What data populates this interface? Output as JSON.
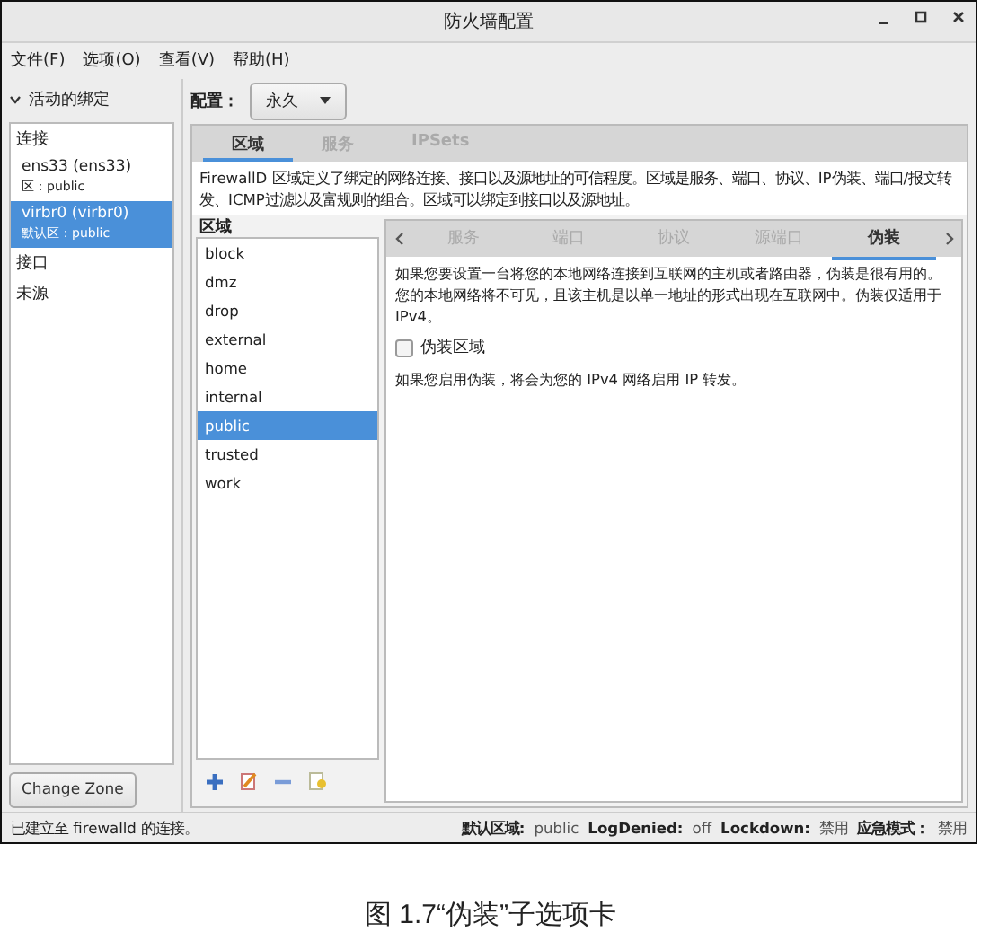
{
  "window": {
    "title": "防火墙配置"
  },
  "menu": [
    "文件(F)",
    "选项(O)",
    "查看(V)",
    "帮助(H)"
  ],
  "sidebar": {
    "header": "活动的绑定",
    "expanded": true,
    "sections": [
      {
        "title": "连接",
        "items": [
          {
            "name": "ens33 (ens33)",
            "detail": "区：public",
            "selected": false
          },
          {
            "name": "virbr0 (virbr0)",
            "detail": "默认区：public",
            "selected": true
          }
        ]
      },
      {
        "title": "接口"
      },
      {
        "title": "未源"
      }
    ],
    "button": "Change Zone"
  },
  "config": {
    "label": "配置：",
    "value": "永久"
  },
  "tabs": [
    {
      "label": "区域",
      "selected": true
    },
    {
      "label": "服务",
      "selected": false
    },
    {
      "label": "IPSets",
      "selected": false
    }
  ],
  "description": "FirewallD 区域定义了绑定的网络连接、接口以及源地址的可信程度。区域是服务、端口、协议、IP伪装、端口/报文转发、ICMP过滤以及富规则的组合。区域可以绑定到接口以及源地址。",
  "zones": {
    "label": "区域",
    "items": [
      {
        "name": "block",
        "selected": false
      },
      {
        "name": "dmz",
        "selected": false
      },
      {
        "name": "drop",
        "selected": false
      },
      {
        "name": "external",
        "selected": false
      },
      {
        "name": "home",
        "selected": false
      },
      {
        "name": "internal",
        "selected": false
      },
      {
        "name": "public",
        "selected": true
      },
      {
        "name": "trusted",
        "selected": false
      },
      {
        "name": "work",
        "selected": false
      }
    ]
  },
  "subtabs": [
    {
      "label": "服务",
      "selected": false
    },
    {
      "label": "端口",
      "selected": false
    },
    {
      "label": "协议",
      "selected": false
    },
    {
      "label": "源端口",
      "selected": false
    },
    {
      "label": "伪装",
      "selected": true
    }
  ],
  "masquerade": {
    "intro": "如果您要设置一台将您的本地网络连接到互联网的主机或者路由器，伪装是很有用的。您的本地网络将不可见，且该主机是以单一地址的形式出现在互联网中。伪装仅适用于 IPv4。",
    "checkbox": {
      "label": "伪装区域",
      "checked": false
    },
    "note": "如果您启用伪装，将会为您的 IPv4 网络启用 IP 转发。"
  },
  "status_bar": {
    "message": "已建立至 firewalld 的连接。",
    "fields": [
      {
        "label": "默认区域:",
        "value": "public"
      },
      {
        "label": "LogDenied:",
        "value": "off"
      },
      {
        "label": "Lockdown:",
        "value": "禁用"
      },
      {
        "label": "应急模式：",
        "value": "禁用"
      }
    ]
  },
  "caption": "图 1.7“伪装”子选项卡"
}
